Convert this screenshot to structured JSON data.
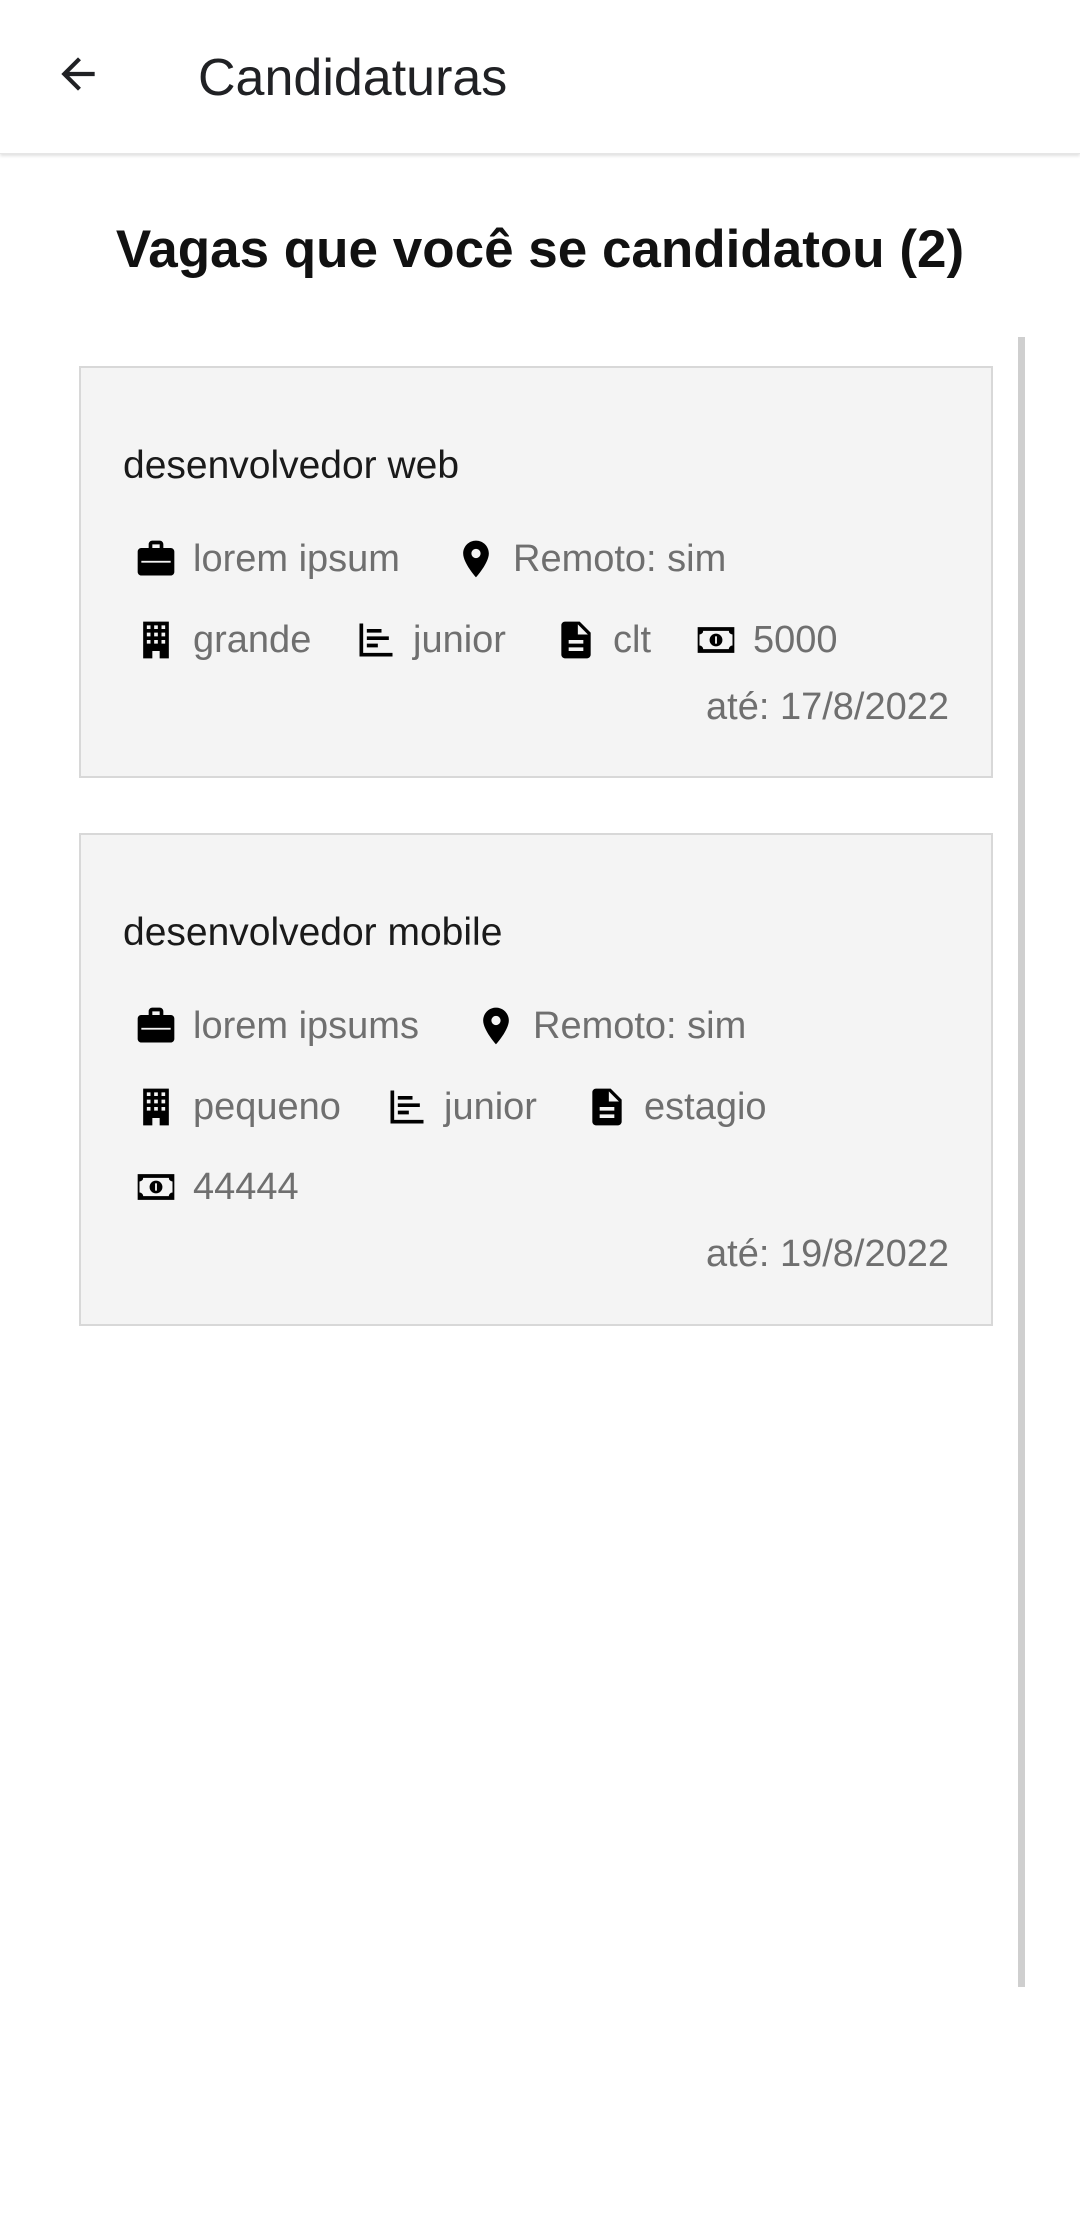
{
  "appbar": {
    "title": "Candidaturas"
  },
  "heading": "Vagas que você se candidatou (2)",
  "jobs": [
    {
      "title": "desenvolvedor web",
      "company": "lorem ipsum",
      "remote": "Remoto: sim",
      "size": "grande",
      "level": "junior",
      "contract": "clt",
      "salary": "5000",
      "deadline": "até: 17/8/2022"
    },
    {
      "title": "desenvolvedor mobile",
      "company": "lorem ipsums",
      "remote": "Remoto: sim",
      "size": "pequeno",
      "level": "junior",
      "contract": "estagio",
      "salary": "44444",
      "deadline": "até: 19/8/2022"
    }
  ],
  "icons": {
    "back": "arrow-back-icon",
    "company": "briefcase-icon",
    "remote": "location-pin-icon",
    "size": "building-icon",
    "level": "bar-chart-icon",
    "contract": "document-icon",
    "salary": "money-icon"
  }
}
